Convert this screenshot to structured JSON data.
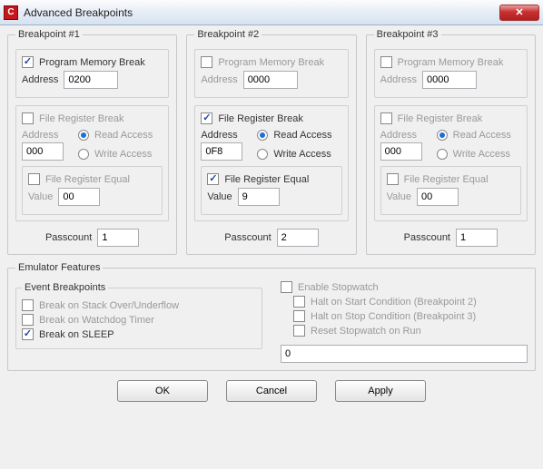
{
  "window": {
    "title": "Advanced Breakpoints",
    "close": "✕"
  },
  "bp": [
    {
      "legend": "Breakpoint #1",
      "pmb": {
        "label": "Program Memory Break",
        "checked": true,
        "addr_label": "Address",
        "addr": "0200"
      },
      "frb": {
        "label": "File Register Break",
        "checked": false,
        "addr_label": "Address",
        "addr": "000",
        "read": "Read Access",
        "write": "Write Access",
        "sel": "read",
        "fre_label": "File Register Equal",
        "fre_checked": false,
        "val_label": "Value",
        "val": "00"
      },
      "pass_label": "Passcount",
      "pass": "1"
    },
    {
      "legend": "Breakpoint #2",
      "pmb": {
        "label": "Program Memory Break",
        "checked": false,
        "addr_label": "Address",
        "addr": "0000"
      },
      "frb": {
        "label": "File Register Break",
        "checked": true,
        "addr_label": "Address",
        "addr": "0F8",
        "read": "Read Access",
        "write": "Write Access",
        "sel": "read",
        "fre_label": "File Register Equal",
        "fre_checked": true,
        "val_label": "Value",
        "val": "9"
      },
      "pass_label": "Passcount",
      "pass": "2"
    },
    {
      "legend": "Breakpoint #3",
      "pmb": {
        "label": "Program Memory Break",
        "checked": false,
        "addr_label": "Address",
        "addr": "0000"
      },
      "frb": {
        "label": "File Register Break",
        "checked": false,
        "addr_label": "Address",
        "addr": "000",
        "read": "Read Access",
        "write": "Write Access",
        "sel": "read",
        "fre_label": "File Register Equal",
        "fre_checked": false,
        "val_label": "Value",
        "val": "00"
      },
      "pass_label": "Passcount",
      "pass": "1"
    }
  ],
  "emu": {
    "legend": "Emulator Features",
    "events": {
      "legend": "Event Breakpoints",
      "stack": {
        "label": "Break on Stack Over/Underflow",
        "checked": false
      },
      "wdt": {
        "label": "Break on Watchdog Timer",
        "checked": false
      },
      "sleep": {
        "label": "Break on SLEEP",
        "checked": true
      }
    },
    "sw": {
      "enable": {
        "label": "Enable Stopwatch",
        "checked": false
      },
      "start": {
        "label": "Halt on Start Condition (Breakpoint 2)",
        "checked": false
      },
      "stop": {
        "label": "Halt on Stop Condition (Breakpoint 3)",
        "checked": false
      },
      "reset": {
        "label": "Reset Stopwatch on Run",
        "checked": false
      },
      "value": "0"
    }
  },
  "buttons": {
    "ok": "OK",
    "cancel": "Cancel",
    "apply": "Apply"
  }
}
